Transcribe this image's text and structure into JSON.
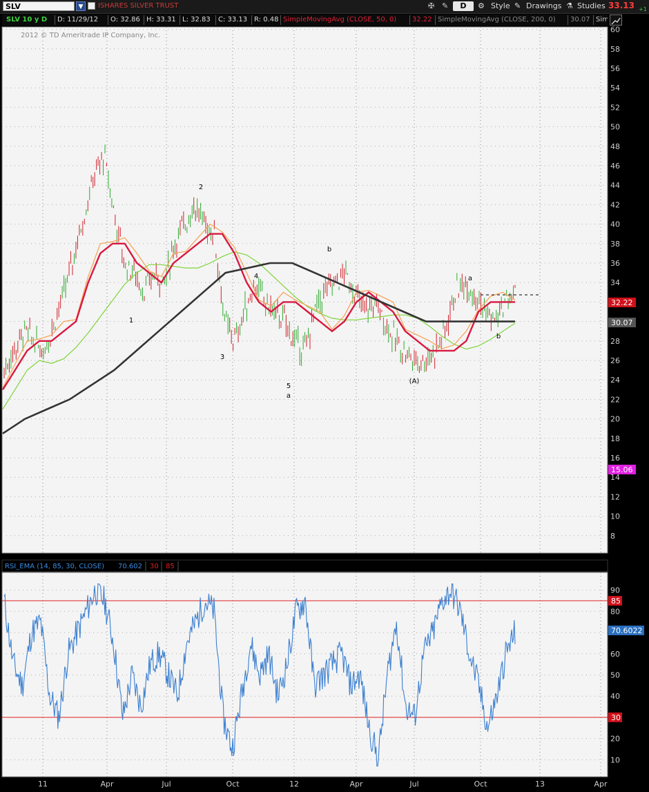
{
  "toolbar": {
    "symbol": "SLV",
    "company": "ISHARES SILVER TRUST",
    "period": "D",
    "style_label": "Style",
    "drawings_label": "Drawings",
    "studies_label": "Studies",
    "last_price": "33.13",
    "change": "+1"
  },
  "info": {
    "title": "SLV 10 y D",
    "date": "D: 11/29/12",
    "open": "O: 32.86",
    "high": "H: 33.31",
    "low": "L: 32.83",
    "close": "C: 33.13",
    "range": "R: 0.48",
    "sma50_label": "SimpleMovingAvg (CLOSE, 50, 0)",
    "sma50_value": "32.22",
    "sma200_label": "SimpleMovingAvg (CLOSE, 200, 0)",
    "sma200_value": "30.07",
    "more": "Sim"
  },
  "copyright": "2012 © TD Ameritrade IP Company, Inc.",
  "colors": {
    "price_up": "#2ea82e",
    "price_down": "#d0202a",
    "sma50": "#d81840",
    "sma200": "#333333",
    "sma_green": "#7ed43a",
    "ema_orange": "#f7a050",
    "rsi_line": "#3a7fd0",
    "level_line": "#e02020",
    "label_red": "#d0101a",
    "label_magenta": "#e020e0",
    "label_gray": "#555555",
    "label_blue": "#2a6fc0"
  },
  "rsi": {
    "title": "RSI_EMA (14, 85, 30, CLOSE)",
    "value": "70.602",
    "oversold": "30",
    "overbought": "85",
    "value_label": "70.6022"
  },
  "chart_data": [
    {
      "type": "candlestick",
      "title": "SLV 10 y D",
      "ylim": [
        6,
        61
      ],
      "yticks": [
        8,
        10,
        12,
        14,
        16,
        18,
        20,
        22,
        24,
        26,
        28,
        30,
        32,
        34,
        36,
        38,
        40,
        42,
        44,
        46,
        48,
        50,
        52,
        54,
        56,
        58,
        60
      ],
      "xtick_labels": [
        "11",
        "Apr",
        "Jul",
        "Oct",
        "12",
        "Apr",
        "Jul",
        "Oct",
        "13",
        "Apr"
      ],
      "grid": true,
      "price_labels": [
        "32.22",
        "30.07",
        "15.06"
      ],
      "annotations": [
        "1",
        "2",
        "3",
        "4",
        "5",
        "a",
        "b",
        "(A)",
        "a",
        "b"
      ],
      "series": [
        {
          "name": "SimpleMovingAvg (CLOSE, 50, 0)",
          "values": [
            23,
            25,
            27,
            28,
            28,
            29,
            30,
            34,
            37,
            38,
            38,
            36,
            35,
            34,
            36,
            37,
            38,
            39,
            39,
            37,
            34,
            32,
            31,
            32,
            32,
            31,
            30,
            29,
            30,
            32,
            33,
            32,
            31,
            29,
            28,
            27,
            27,
            27,
            28,
            31,
            32,
            32,
            32
          ]
        },
        {
          "name": "SimpleMovingAvg (CLOSE, 200, 0)",
          "values": [
            18.5,
            20,
            21,
            22,
            23.5,
            25,
            27,
            29,
            31,
            33,
            35,
            35.5,
            36,
            36,
            35,
            34,
            33,
            32,
            31,
            30,
            30,
            30,
            30,
            30
          ]
        }
      ],
      "price": [
        25,
        27,
        29,
        28,
        27,
        30,
        33,
        37,
        41,
        45,
        47,
        41,
        36,
        35,
        33,
        35,
        34,
        38,
        40,
        42,
        40,
        39,
        30,
        28,
        31,
        34,
        32,
        31,
        30,
        28,
        27,
        31,
        33,
        34,
        35,
        33,
        31,
        32,
        30,
        28,
        27,
        26,
        26,
        27,
        29,
        33,
        34,
        33,
        31,
        30,
        32,
        33
      ]
    },
    {
      "type": "line",
      "title": "RSI_EMA (14, 85, 30, CLOSE)",
      "ylim": [
        5,
        95
      ],
      "yticks": [
        10,
        20,
        30,
        40,
        50,
        60,
        70,
        80,
        90
      ],
      "levels": [
        30,
        85
      ],
      "values": [
        85,
        55,
        45,
        70,
        75,
        40,
        30,
        60,
        70,
        80,
        90,
        85,
        65,
        30,
        50,
        35,
        55,
        60,
        50,
        40,
        65,
        75,
        85,
        80,
        30,
        15,
        40,
        65,
        50,
        60,
        40,
        55,
        80,
        85,
        45,
        50,
        55,
        60,
        45,
        50,
        25,
        10,
        50,
        75,
        35,
        30,
        60,
        70,
        85,
        90,
        80,
        60,
        45,
        25,
        40,
        60,
        70
      ]
    }
  ]
}
